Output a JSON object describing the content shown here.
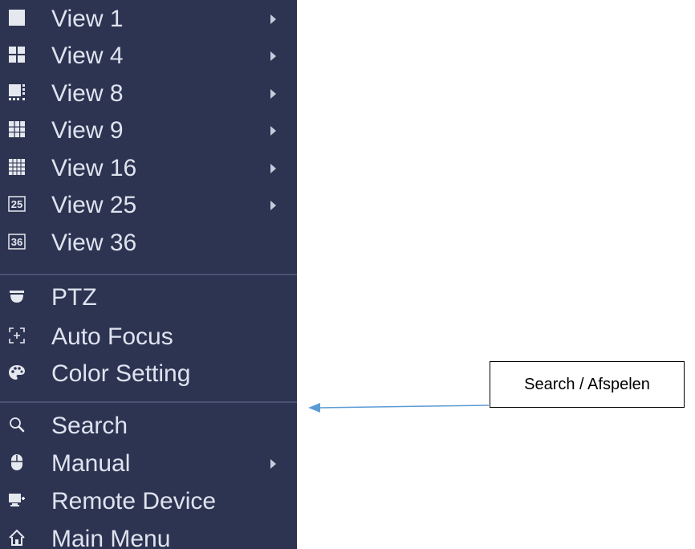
{
  "menu": {
    "items": [
      {
        "label": "View 1",
        "icon": "single-view-icon",
        "has_submenu": true
      },
      {
        "label": "View 4",
        "icon": "quad-view-icon",
        "has_submenu": true
      },
      {
        "label": "View 8",
        "icon": "eight-view-icon",
        "has_submenu": true
      },
      {
        "label": "View 9",
        "icon": "nine-view-icon",
        "has_submenu": true
      },
      {
        "label": "View 16",
        "icon": "sixteen-view-icon",
        "has_submenu": true
      },
      {
        "label": "View 25",
        "icon": "twentyfive-view-icon",
        "icon_text": "25",
        "has_submenu": true
      },
      {
        "label": "View 36",
        "icon": "thirtysix-view-icon",
        "icon_text": "36",
        "has_submenu": false
      },
      {
        "label": "PTZ",
        "icon": "ptz-dome-icon",
        "has_submenu": false
      },
      {
        "label": "Auto Focus",
        "icon": "auto-focus-icon",
        "has_submenu": false
      },
      {
        "label": "Color Setting",
        "icon": "color-palette-icon",
        "has_submenu": false
      },
      {
        "label": "Search",
        "icon": "search-icon",
        "has_submenu": false
      },
      {
        "label": "Manual",
        "icon": "manual-mouse-icon",
        "has_submenu": true
      },
      {
        "label": "Remote Device",
        "icon": "remote-device-icon",
        "has_submenu": false
      },
      {
        "label": "Main Menu",
        "icon": "home-icon",
        "has_submenu": false
      }
    ]
  },
  "callout": {
    "text": "Search / Afspelen"
  },
  "colors": {
    "menu_background": "#2d3451",
    "menu_text": "#dfe3ef",
    "divider": "#4a5373",
    "pointer_arrow": "#5b9bd5"
  }
}
